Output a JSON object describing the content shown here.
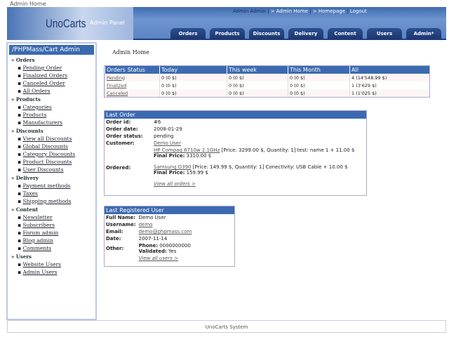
{
  "page_title": "Admin Home",
  "header": {
    "logo": "UnoCarts",
    "logo_sub": "Admin Panel",
    "user": "Admin Admin",
    "links": [
      "> Admin Home",
      "> Homepage",
      "Logout"
    ],
    "tabs": [
      "Orders",
      "Products",
      "Discounts",
      "Delivery",
      "Content",
      "Users",
      "Admin*"
    ]
  },
  "sidebar": {
    "title": "/PHPMass/Cart Admin",
    "groups": [
      {
        "label": "Orders",
        "items": [
          "Pending Order",
          "Finalized Orders",
          "Canceled Order",
          "All Orders"
        ]
      },
      {
        "label": "Products",
        "items": [
          "Categories",
          "Products",
          "Manufacturers"
        ]
      },
      {
        "label": "Discounts",
        "items": [
          "View all Discounts",
          "Global Discounts",
          "Category Discounts",
          "Product Discounts",
          "User Discounts"
        ]
      },
      {
        "label": "Delivery",
        "items": [
          "Payment methods",
          "Taxes",
          "Shipping methods"
        ]
      },
      {
        "label": "Content",
        "items": [
          "Newsletter",
          "Subscribers",
          "Forum admin",
          "Blog admin",
          "Comments"
        ]
      },
      {
        "label": "Users",
        "items": [
          "Website Users",
          "Admin Users"
        ]
      }
    ]
  },
  "main_title": "Admin Home",
  "orders": {
    "headers": [
      "Orders Status",
      "Today",
      "This week",
      "This Month",
      "All"
    ],
    "rows": [
      [
        "Pending",
        "0 (0 $)",
        "0 (0 $)",
        "0 (0 $)",
        "4 (14'548.99 $)"
      ],
      [
        "Finalized",
        "0 (0 $)",
        "0 (0 $)",
        "0 (0 $)",
        "1 (3'629 $)"
      ],
      [
        "Canceled",
        "0 (0 $)",
        "0 (0 $)",
        "0 (0 $)",
        "1 (1'025 $)"
      ]
    ]
  },
  "last_order": {
    "title": "Last Order",
    "labels": [
      "Order id:",
      "Order date:",
      "Order status:",
      "Customer:",
      "Ordered:"
    ],
    "id": "#6",
    "date": "2008-01-29",
    "status": "pending",
    "customer": "Demo User",
    "item1_link": "HP Compaq 6710w 2.1GHz",
    "item1_text": " [Price: 3299.00 $, Quantity: 1] test: name 1 + 11.00 $",
    "final_label": "Final Price:",
    "item1_final": " 3310.00 $",
    "item2_link": "Samsung D390",
    "item2_text": " [Price: 149.99 $, Quantity: 1] Conectivity: USB Cable + 10.00 $",
    "item2_final": " 159.99 $",
    "view_all": "View all orders >"
  },
  "last_user": {
    "title": "Last Registered User",
    "labels": [
      "Full Name:",
      "Username:",
      "Email:",
      "Date:",
      "Other:"
    ],
    "full_name": "Demo User",
    "username": "demo",
    "email": "demo@phpmass.com",
    "date": "2007-11-14",
    "phone_label": "Phone:",
    "phone": " 0000000000",
    "validated_label": "Validated:",
    "validated": " Yes",
    "view_all": "View all users >"
  },
  "footer": "UnoCarts System"
}
